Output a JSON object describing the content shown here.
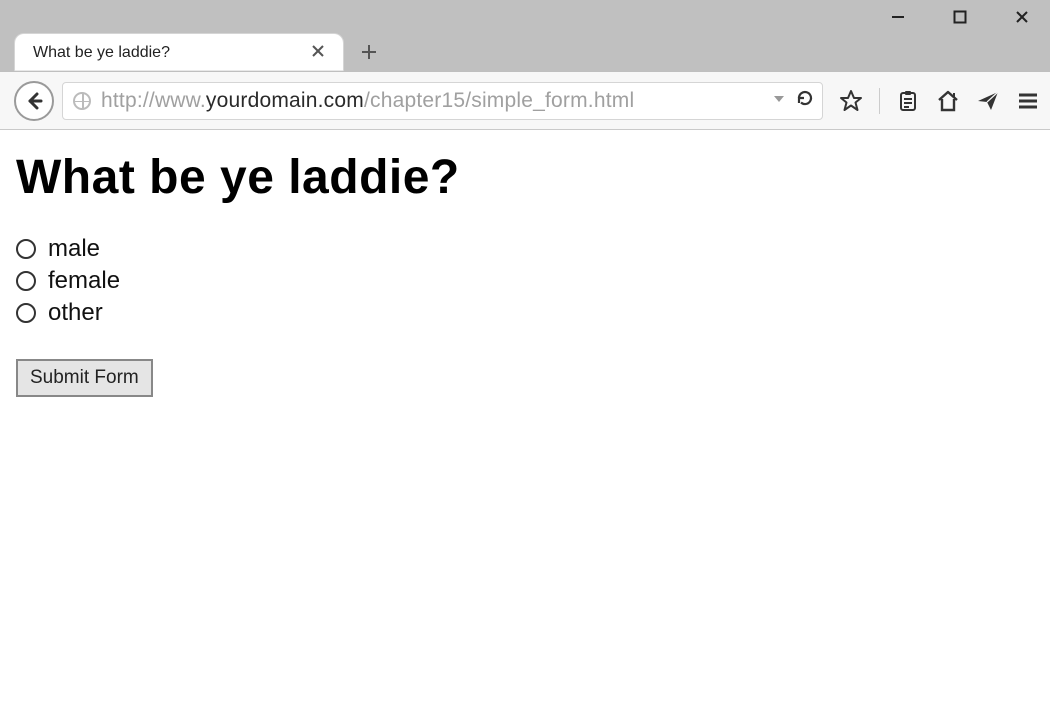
{
  "window": {
    "controls": {
      "minimize": "–",
      "maximize": "□",
      "close": "✕"
    }
  },
  "browser": {
    "tab": {
      "title": "What be ye laddie?"
    },
    "url": {
      "scheme": "http://",
      "prefix": "www.",
      "domain": "yourdomain.com",
      "path": "/chapter15/simple_form.html"
    }
  },
  "page": {
    "heading": "What be ye laddie?",
    "options": [
      {
        "label": "male"
      },
      {
        "label": "female"
      },
      {
        "label": "other"
      }
    ],
    "submit_label": "Submit Form"
  }
}
